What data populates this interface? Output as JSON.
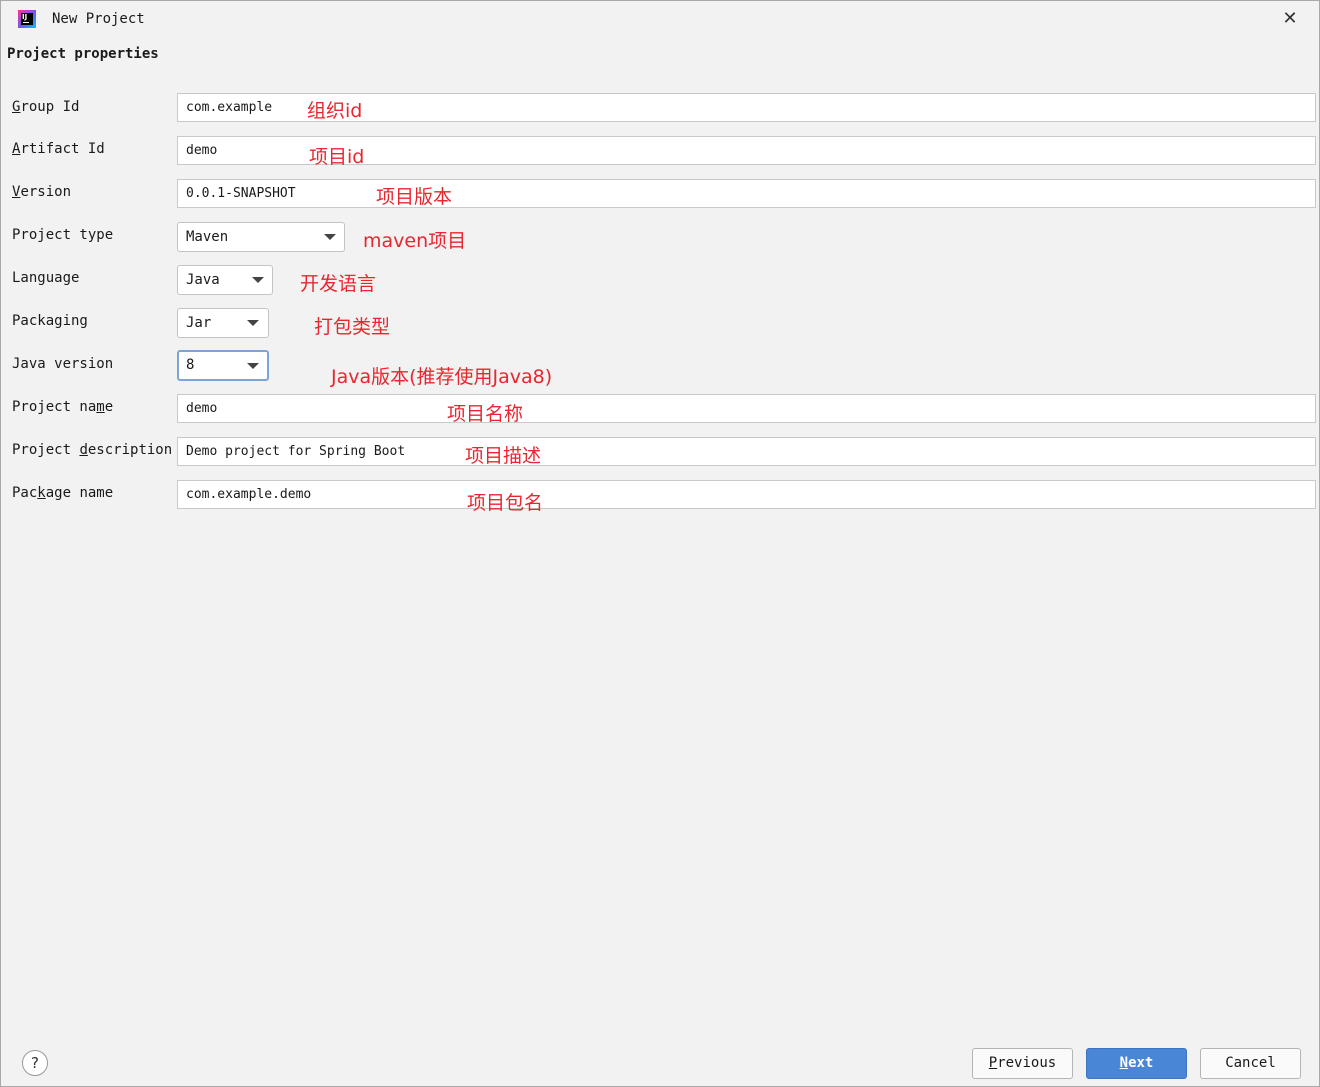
{
  "window": {
    "title": "New Project",
    "app_icon": "intellij-idea-icon",
    "app_icon_text": "IJ",
    "close_icon": "close-icon",
    "close_glyph": "✕"
  },
  "section_title": "Project properties",
  "fields": {
    "group_id": {
      "label_pre": "",
      "label_mn": "G",
      "label_post": "roup Id",
      "value": "com.example",
      "note": "组织id"
    },
    "artifact_id": {
      "label_pre": "",
      "label_mn": "A",
      "label_post": "rtifact Id",
      "value": "demo",
      "note": "项目id"
    },
    "version": {
      "label_pre": "",
      "label_mn": "V",
      "label_post": "ersion",
      "value": "0.0.1-SNAPSHOT",
      "note": "项目版本"
    },
    "project_type": {
      "label": "Project type",
      "value": "Maven",
      "note": "maven项目"
    },
    "language": {
      "label": "Language",
      "value": "Java",
      "note": "开发语言"
    },
    "packaging": {
      "label": "Packaging",
      "value": "Jar",
      "note": "打包类型"
    },
    "java_version": {
      "label": "Java version",
      "value": "8",
      "note": "Java版本(推荐使用Java8)"
    },
    "project_name": {
      "label_pre": "Project na",
      "label_mn": "m",
      "label_post": "e",
      "value": "demo",
      "note": "项目名称"
    },
    "project_description": {
      "label_pre": "Project ",
      "label_mn": "d",
      "label_post": "escription",
      "value": "Demo project for Spring Boot",
      "note": "项目描述"
    },
    "package_name": {
      "label_pre": "Pac",
      "label_mn": "k",
      "label_post": "age name",
      "value": "com.example.demo",
      "note": "项目包名"
    }
  },
  "footer": {
    "help_glyph": "?",
    "previous": {
      "mn": "P",
      "rest": "revious"
    },
    "next": {
      "mn": "N",
      "rest": "ext"
    },
    "cancel": "Cancel"
  },
  "colors": {
    "annotation": "#e9262f",
    "primary_button": "#4a86d6",
    "focus_border": "#7ca4d9",
    "background": "#f2f2f2"
  }
}
